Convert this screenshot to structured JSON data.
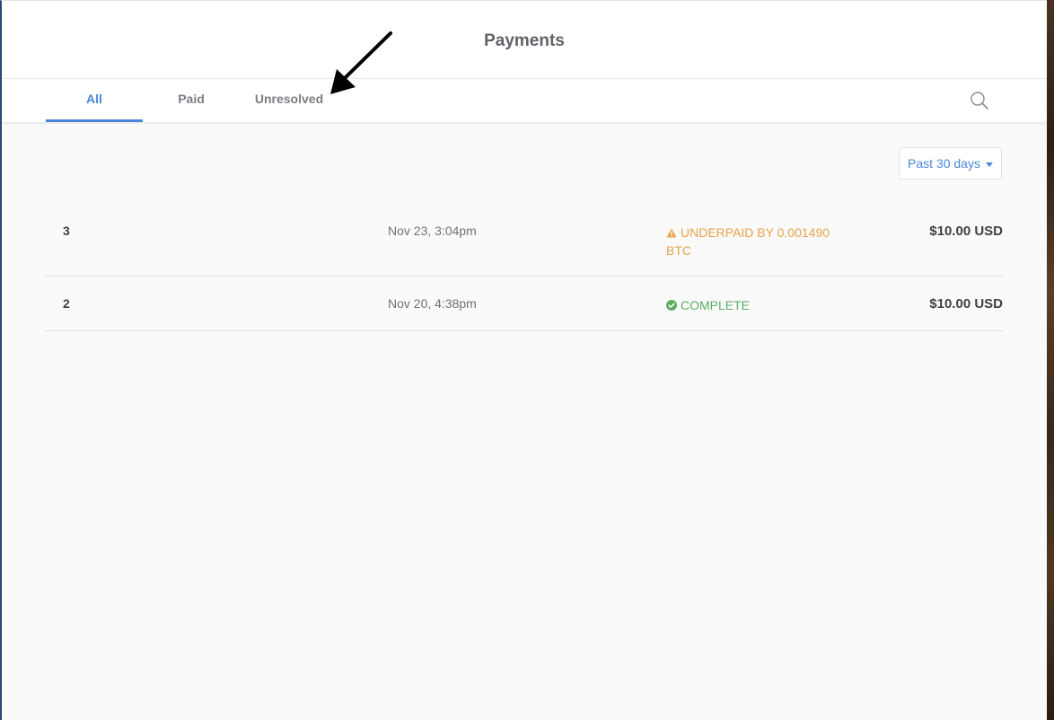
{
  "header": {
    "title": "Payments"
  },
  "tabs": [
    {
      "label": "All",
      "active": true
    },
    {
      "label": "Paid",
      "active": false
    },
    {
      "label": "Unresolved",
      "active": false
    }
  ],
  "toolbar": {
    "search_icon": "search-icon"
  },
  "filter": {
    "selected": "Past 30 days",
    "icon": "caret-down-icon"
  },
  "payments": [
    {
      "id": "3",
      "date": "Nov 23, 3:04pm",
      "status": "UNDERPAID BY 0.001490 BTC",
      "status_icon": "warning-icon",
      "status_color": "#e8a34a",
      "amount": "$10.00 USD"
    },
    {
      "id": "2",
      "date": "Nov 20, 4:38pm",
      "status": "COMPLETE",
      "status_icon": "check-circle-icon",
      "status_color": "#5cae62",
      "amount": "$10.00 USD"
    }
  ],
  "colors": {
    "accent": "#4a86d8",
    "warning": "#e8a34a",
    "success": "#5cae62",
    "background": "#fafafa"
  }
}
